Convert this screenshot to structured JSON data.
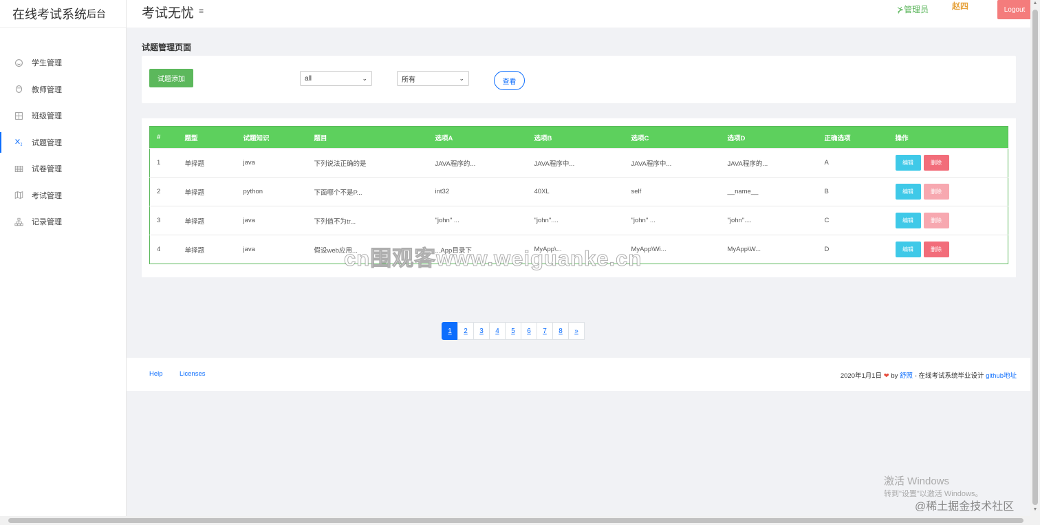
{
  "brand": {
    "main": "在线考试系统",
    "sub": "后台"
  },
  "sidebar": {
    "items": [
      {
        "label": "学生管理",
        "icon": "smile-icon"
      },
      {
        "label": "教师管理",
        "icon": "user-icon"
      },
      {
        "label": "班级管理",
        "icon": "grid-icon"
      },
      {
        "label": "试题管理",
        "icon": "subscript-icon",
        "active": true
      },
      {
        "label": "试卷管理",
        "icon": "table-icon"
      },
      {
        "label": "考试管理",
        "icon": "map-icon"
      },
      {
        "label": "记录管理",
        "icon": "hierarchy-icon"
      }
    ]
  },
  "topbar": {
    "title": "考试无忧",
    "admin_label": "管理员",
    "admin_glyph": "⊁",
    "username": "赵四",
    "logout_label": "Logout"
  },
  "page": {
    "heading": "试题管理页面",
    "add_label": "试题添加",
    "select1_value": "all",
    "select2_value": "所有",
    "view_label": "查看"
  },
  "table": {
    "headers": [
      "#",
      "题型",
      "试题知识",
      "题目",
      "选项A",
      "选项B",
      "选项C",
      "选项D",
      "正确选项",
      "操作"
    ],
    "edit_label": "编辑",
    "delete_label": "删除",
    "rows": [
      [
        "1",
        "单择题",
        "java",
        "下列说法正确的是",
        "JAVA程序的...",
        "JAVA程序中...",
        "JAVA程序中...",
        "JAVA程序的...",
        "A"
      ],
      [
        "2",
        "单择题",
        "python",
        "下面哪个不是P...",
        "int32",
        "40XL",
        "self",
        "__name__",
        "B"
      ],
      [
        "3",
        "单择题",
        "java",
        "下列值不为tr...",
        "\"john\" ...",
        "\"john\"....",
        "\"john\" ...",
        "\"john\"....",
        "C"
      ],
      [
        "4",
        "单择题",
        "java",
        "假设web应用...",
        "...App目录下",
        "MyApp\\...",
        "MyApp\\Wi...",
        "MyApp\\W...",
        "D"
      ]
    ]
  },
  "pagination": {
    "pages": [
      "1",
      "2",
      "3",
      "4",
      "5",
      "6",
      "7",
      "8"
    ],
    "next": "»",
    "active": "1"
  },
  "footer": {
    "help": "Help",
    "licenses": "Licenses",
    "date": "2020年1月1日",
    "heart": "❤",
    "by": "by",
    "author": "舒照",
    "desc": "- 在线考试系统毕业设计",
    "github": "github地址"
  },
  "watermarks": {
    "site": "cn围观客www.weiguanke.cn",
    "windows_title": "激活 Windows",
    "windows_sub": "转到\"设置\"以激活 Windows。",
    "juejin": "@稀土掘金技术社区"
  },
  "colors": {
    "primary": "#0d6efd",
    "success": "#5cb85c",
    "table_header": "#5dd05d",
    "info": "#3fc9e8",
    "danger": "#f26d7a",
    "logout": "#f47c7c"
  }
}
